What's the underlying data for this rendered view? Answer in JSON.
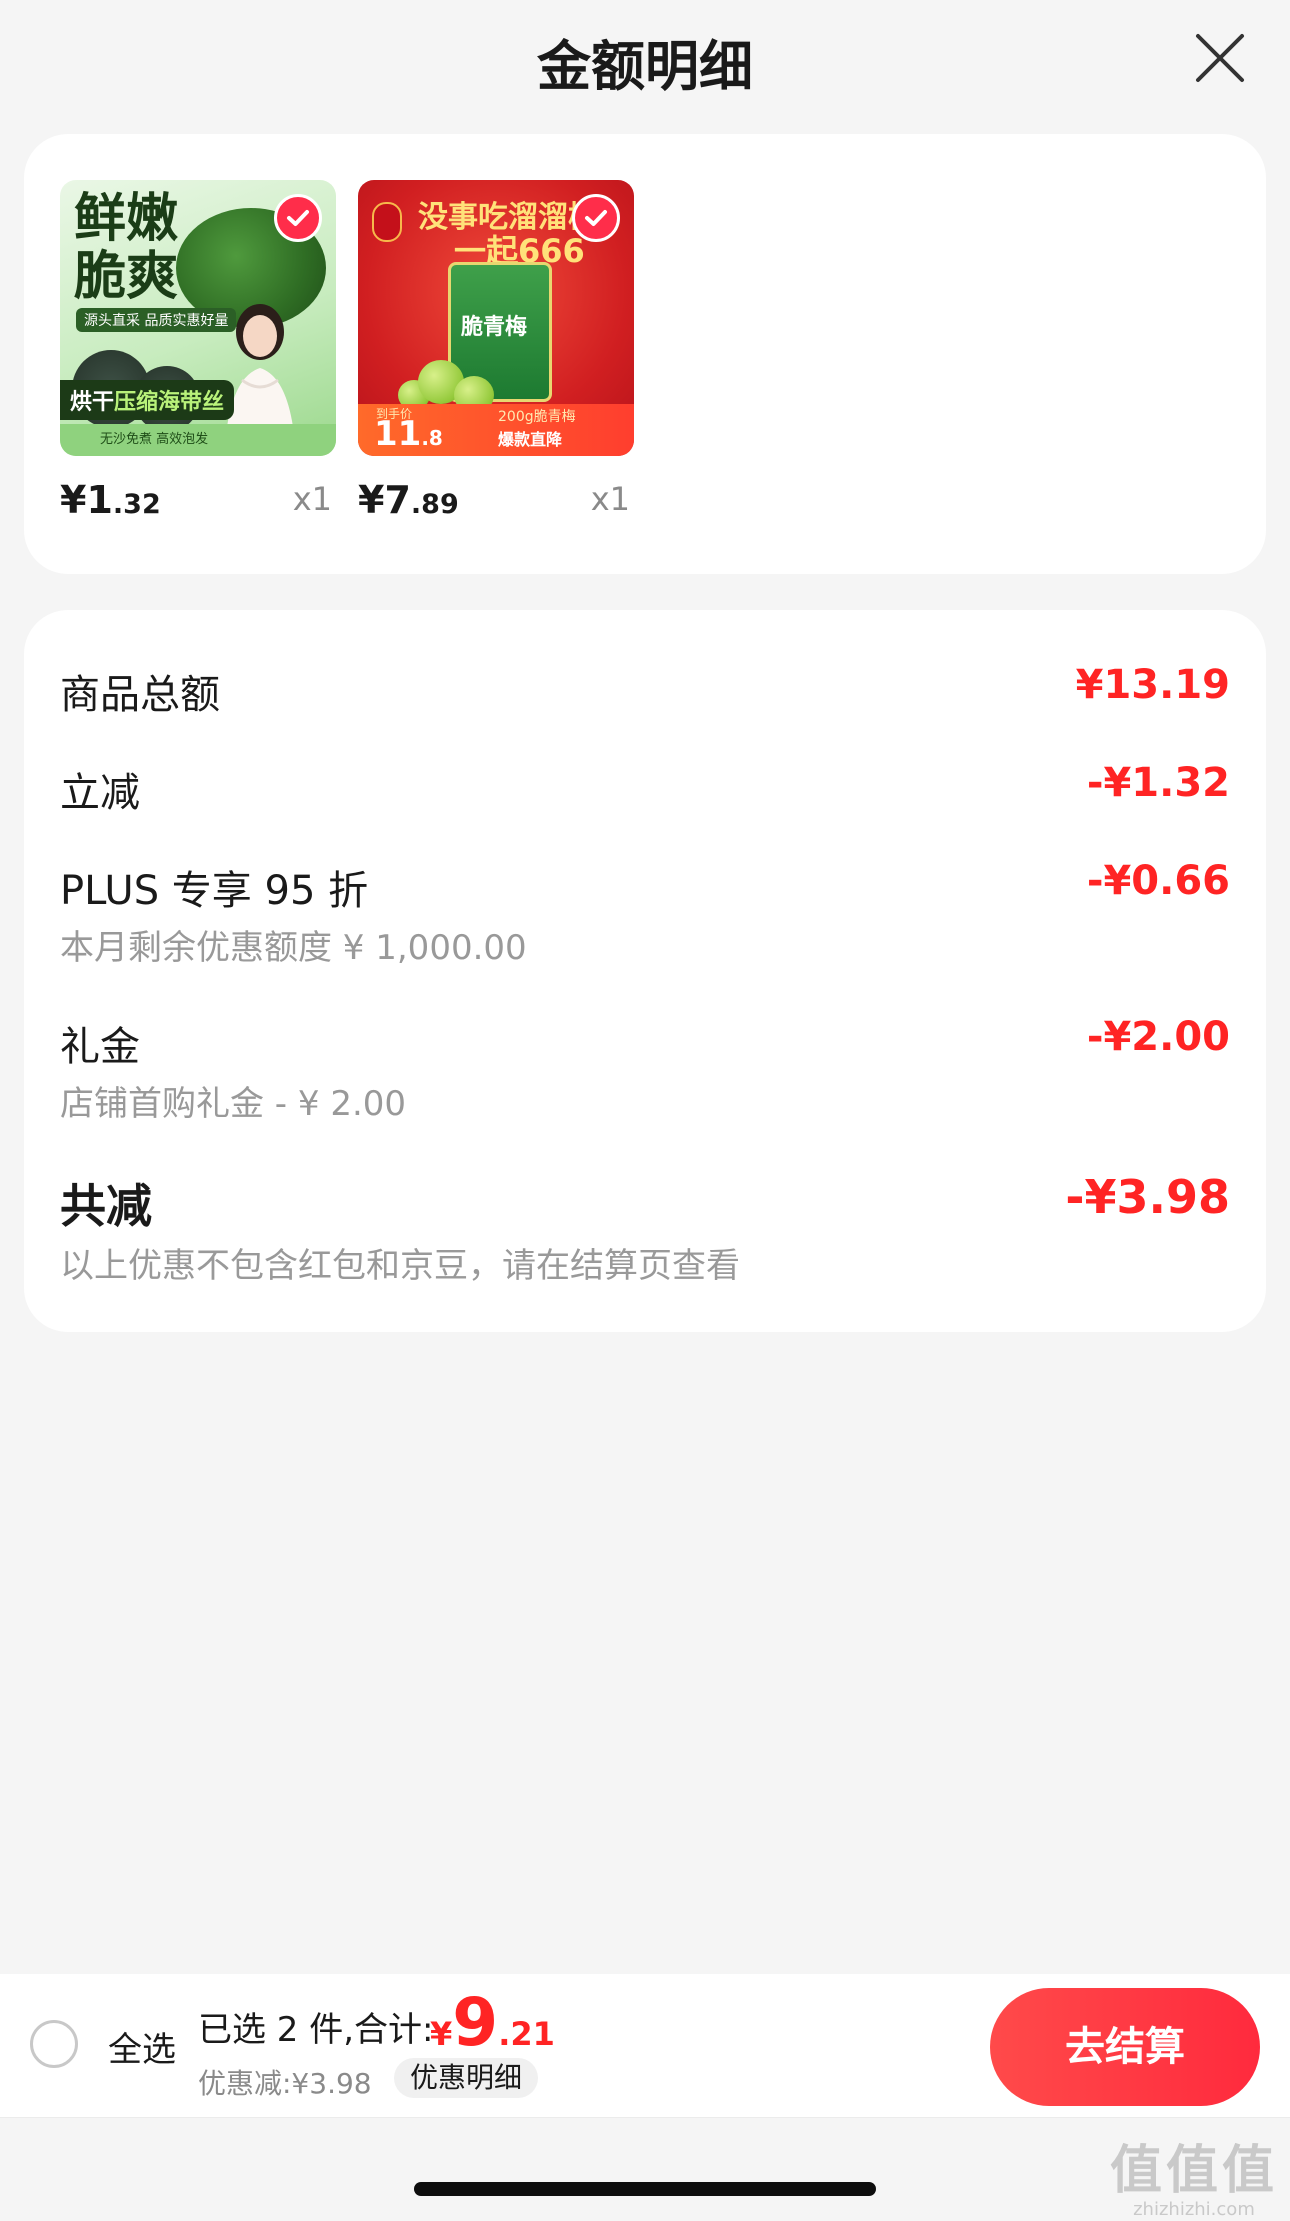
{
  "header": {
    "title": "金额明细"
  },
  "products": [
    {
      "image": {
        "headline_1": "鲜嫩",
        "headline_2": "脆爽",
        "tag": "源头直采 品质实惠好量",
        "banner_prefix": "烘干",
        "banner_highlight": "压缩海带丝",
        "footer": "无沙免煮 高效泡发"
      },
      "price_symbol": "¥",
      "price_int": "1",
      "price_dec": ".32",
      "qty": "x1",
      "checked": true
    },
    {
      "image": {
        "slogan_1": "没事吃溜溜梅",
        "slogan_2": "一起666",
        "pack_name": "脆青梅",
        "price_label": "到手价",
        "price_int": "11",
        "price_dec": ".8",
        "note_1": "200g脆青梅",
        "note_2": "爆款直降"
      },
      "price_symbol": "¥",
      "price_int": "7",
      "price_dec": ".89",
      "qty": "x1",
      "checked": true
    }
  ],
  "summary": {
    "goods_total_label": "商品总额",
    "goods_total_value": "¥13.19",
    "instant_label": "立减",
    "instant_value": "-¥1.32",
    "plus_label": "PLUS 专享 95 折",
    "plus_value": "-¥0.66",
    "plus_sub": "本月剩余优惠额度 ¥ 1,000.00",
    "gift_label": "礼金",
    "gift_value": "-¥2.00",
    "gift_sub": "店铺首购礼金 - ¥ 2.00",
    "total_label": "共减",
    "total_value": "-¥3.98",
    "total_sub": "以上优惠不包含红包和京豆，请在结算页查看"
  },
  "bottom_bar": {
    "select_all": "全选",
    "selected_text": "已选 2 件,合计:",
    "total_symbol": "¥",
    "total_int": "9",
    "total_dec": ".21",
    "discount_text": "优惠减:¥3.98",
    "detail_chip": "优惠明细",
    "checkout": "去结算"
  },
  "watermark": {
    "main": "值值值",
    "sub": "zhizhizhi.com"
  },
  "colors": {
    "accent": "#ff2424",
    "checkout": "#ff3a44",
    "background": "#f5f5f5"
  }
}
